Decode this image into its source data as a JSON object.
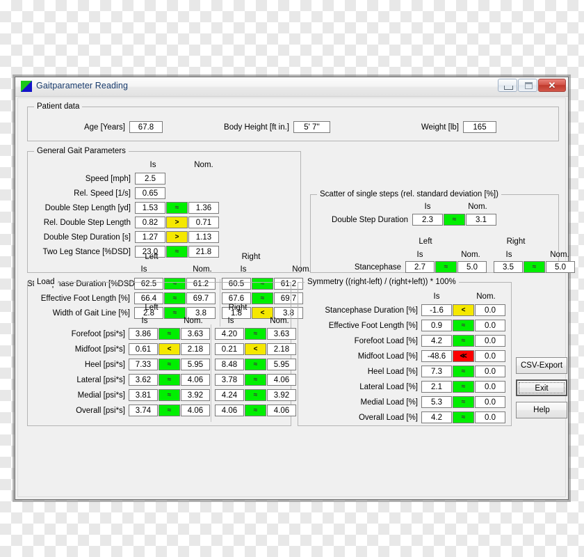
{
  "window": {
    "title": "Gaitparameter Reading",
    "icon": "app-icon",
    "buttons": {
      "minimize": "minimize",
      "maximize": "maximize",
      "close": "✕"
    }
  },
  "patient": {
    "legend": "Patient data",
    "age_label": "Age [Years]",
    "age_value": "67.8",
    "height_label": "Body Height [ft in.]",
    "height_value": "5' 7''",
    "weight_label": "Weight [lb]",
    "weight_value": "165"
  },
  "general": {
    "legend": "General Gait Parameters",
    "col_is": "Is",
    "col_nom": "Nom.",
    "col_left": "Left",
    "col_right": "Right",
    "simple_rows": [
      {
        "label": "Speed [mph]",
        "is": "2.5",
        "cmp": "",
        "nom": ""
      },
      {
        "label": "Rel. Speed [1/s]",
        "is": "0.65",
        "cmp": "",
        "nom": ""
      },
      {
        "label": "Double Step Length [yd]",
        "is": "1.53",
        "cmp": "≈",
        "cmp_state": "eq",
        "nom": "1.36"
      },
      {
        "label": "Rel. Double Step Length",
        "is": "0.82",
        "cmp": ">",
        "cmp_state": "gt",
        "nom": "0.71"
      },
      {
        "label": "Double Step Duration [s]",
        "is": "1.27",
        "cmp": ">",
        "cmp_state": "gt",
        "nom": "1.13"
      },
      {
        "label": "Two Leg Stance [%DSD]",
        "is": "23.0",
        "cmp": "≈",
        "cmp_state": "eq",
        "nom": "21.8"
      }
    ],
    "lr_rows": [
      {
        "label": "Stancephase Duration [%DSD]",
        "left_is": "62.5",
        "left_cmp": "≈",
        "left_state": "eq",
        "left_nom": "61.2",
        "right_is": "60.5",
        "right_cmp": "≈",
        "right_state": "eq",
        "right_nom": "61.2"
      },
      {
        "label": "Effective Foot Length [%]",
        "left_is": "66.4",
        "left_cmp": "≈",
        "left_state": "eq",
        "left_nom": "69.7",
        "right_is": "67.6",
        "right_cmp": "≈",
        "right_state": "eq",
        "right_nom": "69.7"
      },
      {
        "label": "Width of Gait Line [%]",
        "left_is": "2.8",
        "left_cmp": "≈",
        "left_state": "eq",
        "left_nom": "3.8",
        "right_is": "1.8",
        "right_cmp": "<",
        "right_state": "lt",
        "right_nom": "3.8"
      }
    ]
  },
  "scatter": {
    "legend": "Scatter of single steps (rel. standard deviation [%])",
    "col_is": "Is",
    "col_nom": "Nom.",
    "col_left": "Left",
    "col_right": "Right",
    "row_dsd": {
      "label": "Double Step Duration",
      "is": "2.3",
      "cmp": "≈",
      "cmp_state": "eq",
      "nom": "3.1"
    },
    "row_stance": {
      "label": "Stancephase",
      "left_is": "2.7",
      "left_cmp": "≈",
      "left_state": "eq",
      "left_nom": "5.0",
      "right_is": "3.5",
      "right_cmp": "≈",
      "right_state": "eq",
      "right_nom": "5.0"
    }
  },
  "load": {
    "legend": "Load",
    "col_is": "Is",
    "col_nom": "Nom.",
    "col_left": "Left",
    "col_right": "Right",
    "rows": [
      {
        "label": "Forefoot [psi*s]",
        "left_is": "3.86",
        "left_cmp": "≈",
        "left_state": "eq",
        "left_nom": "3.63",
        "right_is": "4.20",
        "right_cmp": "≈",
        "right_state": "eq",
        "right_nom": "3.63"
      },
      {
        "label": "Midfoot [psi*s]",
        "left_is": "0.61",
        "left_cmp": "<",
        "left_state": "lt",
        "left_nom": "2.18",
        "right_is": "0.21",
        "right_cmp": "<",
        "right_state": "lt",
        "right_nom": "2.18"
      },
      {
        "label": "Heel [psi*s]",
        "left_is": "7.33",
        "left_cmp": "≈",
        "left_state": "eq",
        "left_nom": "5.95",
        "right_is": "8.48",
        "right_cmp": "≈",
        "right_state": "eq",
        "right_nom": "5.95"
      },
      {
        "label": "Lateral [psi*s]",
        "left_is": "3.62",
        "left_cmp": "≈",
        "left_state": "eq",
        "left_nom": "4.06",
        "right_is": "3.78",
        "right_cmp": "≈",
        "right_state": "eq",
        "right_nom": "4.06"
      },
      {
        "label": "Medial [psi*s]",
        "left_is": "3.81",
        "left_cmp": "≈",
        "left_state": "eq",
        "left_nom": "3.92",
        "right_is": "4.24",
        "right_cmp": "≈",
        "right_state": "eq",
        "right_nom": "3.92"
      },
      {
        "label": "Overall [psi*s]",
        "left_is": "3.74",
        "left_cmp": "≈",
        "left_state": "eq",
        "left_nom": "4.06",
        "right_is": "4.06",
        "right_cmp": "≈",
        "right_state": "eq",
        "right_nom": "4.06"
      }
    ]
  },
  "symmetry": {
    "legend": "Symmetry ((right-left) / (right+left)) * 100%",
    "col_is": "Is",
    "col_nom": "Nom.",
    "rows": [
      {
        "label": "Stancephase Duration [%]",
        "is": "-1.6",
        "cmp": "<",
        "cmp_state": "lt",
        "nom": "0.0"
      },
      {
        "label": "Effective Foot Length [%]",
        "is": "0.9",
        "cmp": "≈",
        "cmp_state": "eq",
        "nom": "0.0"
      },
      {
        "label": "Forefoot Load [%]",
        "is": "4.2",
        "cmp": "≈",
        "cmp_state": "eq",
        "nom": "0.0"
      },
      {
        "label": "Midfoot Load [%]",
        "is": "-48.6",
        "cmp": "≪",
        "cmp_state": "ll",
        "nom": "0.0"
      },
      {
        "label": "Heel Load [%]",
        "is": "7.3",
        "cmp": "≈",
        "cmp_state": "eq",
        "nom": "0.0"
      },
      {
        "label": "Lateral Load [%]",
        "is": "2.1",
        "cmp": "≈",
        "cmp_state": "eq",
        "nom": "0.0"
      },
      {
        "label": "Medial Load [%]",
        "is": "5.3",
        "cmp": "≈",
        "cmp_state": "eq",
        "nom": "0.0"
      },
      {
        "label": "Overall Load [%]",
        "is": "4.2",
        "cmp": "≈",
        "cmp_state": "eq",
        "nom": "0.0"
      }
    ]
  },
  "actions": {
    "csv_export": "CSV-Export",
    "exit": "Exit",
    "help": "Help"
  },
  "colors": {
    "ok": "#00ef00",
    "warn": "#f5e800",
    "bad": "#fb0000",
    "title_text": "#16396b",
    "face": "#f0f0f0"
  }
}
